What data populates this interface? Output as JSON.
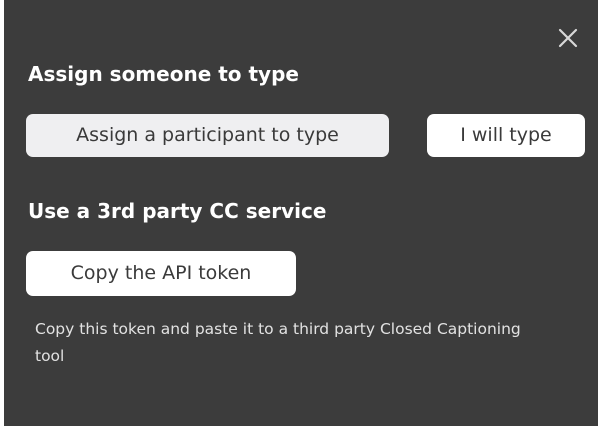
{
  "dialog": {
    "close_icon": "close-icon"
  },
  "assign_section": {
    "heading": "Assign someone to type",
    "assign_participant_label": "Assign a participant to type",
    "self_type_label": "I will type"
  },
  "third_party_section": {
    "heading": "Use a 3rd party CC service",
    "copy_token_label": "Copy the API token",
    "description": "Copy this token and paste it to a third party Closed Captioning tool"
  },
  "colors": {
    "panel_background": "#3c3c3c",
    "button_background": "#ffffff",
    "button_text": "#3a3a3a",
    "heading_text": "#ffffff",
    "description_text": "#e2e2e2"
  }
}
